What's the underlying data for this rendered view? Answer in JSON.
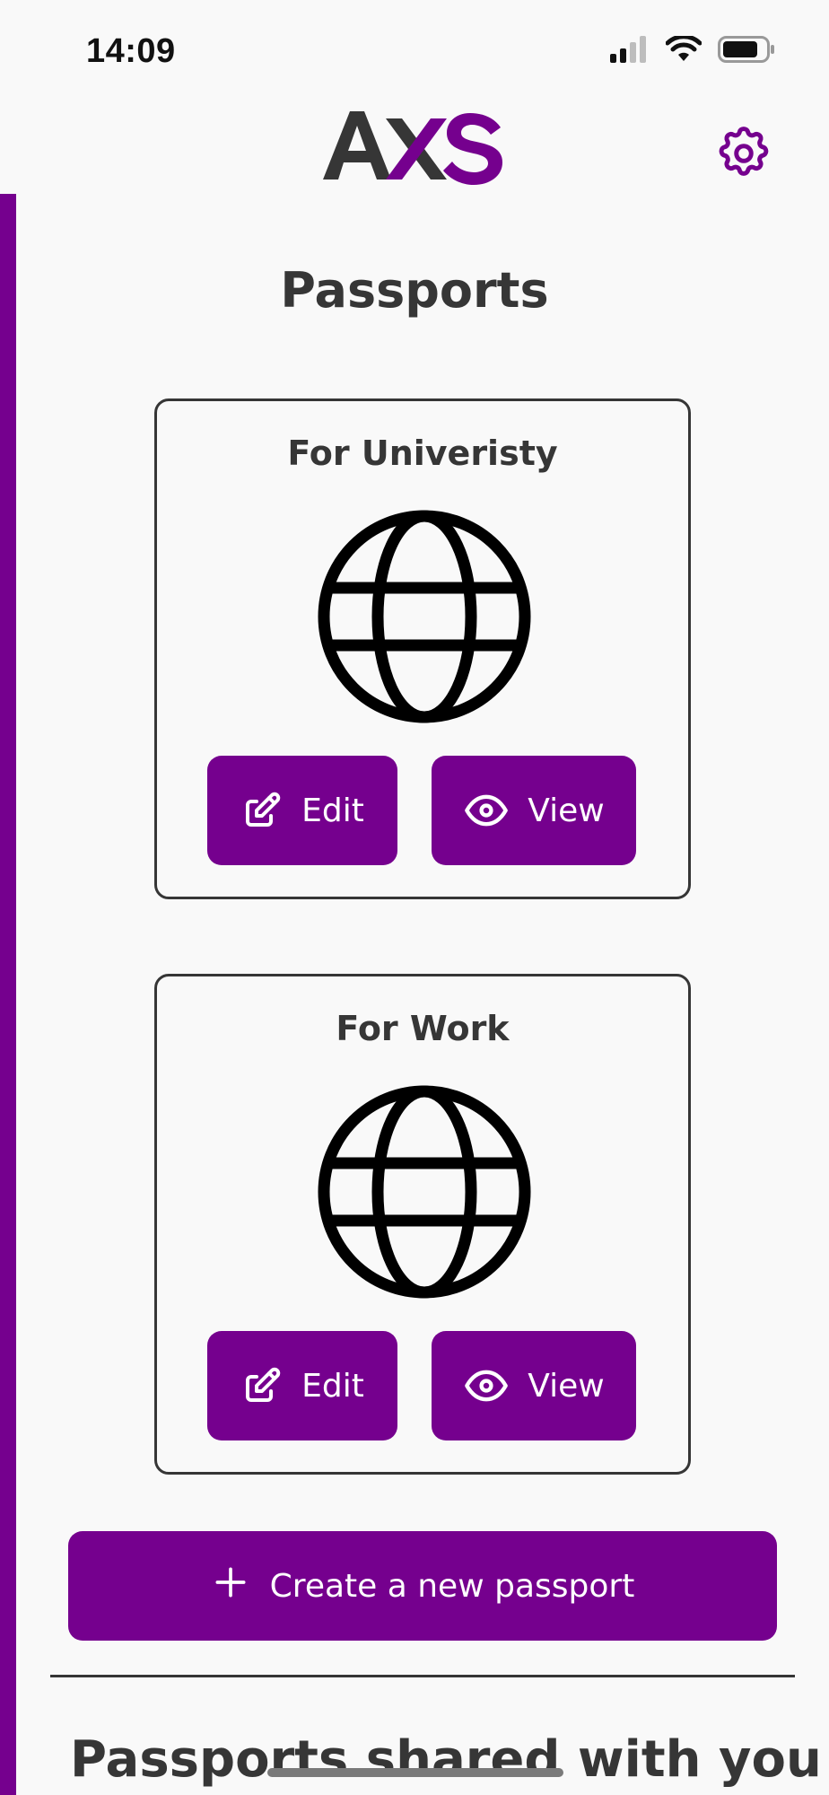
{
  "status_bar": {
    "time": "14:09",
    "icons": [
      "signal-icon",
      "wifi-icon",
      "battery-icon"
    ]
  },
  "header": {
    "logo_text": "AXS",
    "settings_icon": "gear-icon"
  },
  "page": {
    "title": "Passports"
  },
  "passports": [
    {
      "title": "For Univeristy",
      "icon": "globe-icon",
      "edit_label": "Edit",
      "view_label": "View"
    },
    {
      "title": "For Work",
      "icon": "globe-icon",
      "edit_label": "Edit",
      "view_label": "View"
    }
  ],
  "create_button": {
    "label": "Create a new passport",
    "icon": "plus-icon"
  },
  "shared_section": {
    "title": "Passports shared with you"
  },
  "colors": {
    "accent": "#75008e",
    "text": "#363636",
    "background": "#f9f9f9"
  }
}
